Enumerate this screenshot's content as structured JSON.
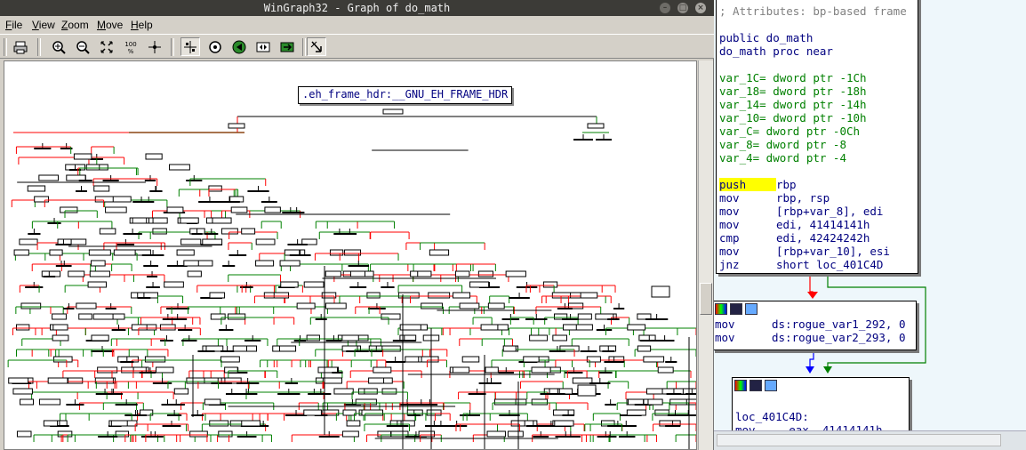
{
  "wingraph": {
    "title": "WinGraph32 - Graph of do_math",
    "menu": [
      "File",
      "View",
      "Zoom",
      "Move",
      "Help"
    ],
    "toolbar": [
      {
        "name": "print-icon"
      },
      {
        "name": "zoom-in-icon"
      },
      {
        "name": "zoom-out-icon"
      },
      {
        "name": "fit-window-icon"
      },
      {
        "name": "zoom-100-icon",
        "label": "100\n%"
      },
      {
        "name": "center-icon"
      },
      {
        "name": "layout-icon"
      },
      {
        "name": "overview-icon"
      },
      {
        "name": "nav-back-icon"
      },
      {
        "name": "nav-toggle-icon"
      },
      {
        "name": "nav-forward-icon"
      },
      {
        "name": "pointer-icon"
      }
    ],
    "node_label": ".eh_frame_hdr:__GNU_EH_FRAME_HDR"
  },
  "ida": {
    "header_block": {
      "lines": [
        {
          "t": "; Attributes: bp-based frame",
          "c": "comment"
        },
        {
          "t": "",
          "c": ""
        },
        {
          "t": "public do_math",
          "c": "kw"
        },
        {
          "t": "do_math proc near",
          "c": "kw"
        },
        {
          "t": "",
          "c": ""
        },
        {
          "t": "var_1C= dword ptr -1Ch",
          "c": "var"
        },
        {
          "t": "var_18= dword ptr -18h",
          "c": "var"
        },
        {
          "t": "var_14= dword ptr -14h",
          "c": "var"
        },
        {
          "t": "var_10= dword ptr -10h",
          "c": "var"
        },
        {
          "t": "var_C= dword ptr -0Ch",
          "c": "var"
        },
        {
          "t": "var_8= dword ptr -8",
          "c": "var"
        },
        {
          "t": "var_4= dword ptr -4",
          "c": "var"
        },
        {
          "t": "",
          "c": ""
        }
      ],
      "instructions": [
        {
          "mn": "push",
          "ops": "rbp",
          "hl": true
        },
        {
          "mn": "mov",
          "ops": "rbp, rsp"
        },
        {
          "mn": "mov",
          "ops": "[rbp+var_8], edi"
        },
        {
          "mn": "mov",
          "ops": "edi, 41414141h"
        },
        {
          "mn": "cmp",
          "ops": "edi, 42424242h"
        },
        {
          "mn": "mov",
          "ops": "[rbp+var_10], esi"
        },
        {
          "mn": "jnz",
          "ops": "short loc_401C4D"
        }
      ]
    },
    "block2": {
      "instructions": [
        {
          "mn": "mov",
          "ops": "ds:rogue_var1_292, 0"
        },
        {
          "mn": "mov",
          "ops": "ds:rogue_var2_293, 0"
        }
      ]
    },
    "block3": {
      "label": "loc_401C4D:",
      "partial": "mov     eax, 41414141h"
    },
    "colors": {
      "edge_false": "#ff0000",
      "edge_true": "#008000",
      "edge_jump": "#0000ff"
    }
  }
}
